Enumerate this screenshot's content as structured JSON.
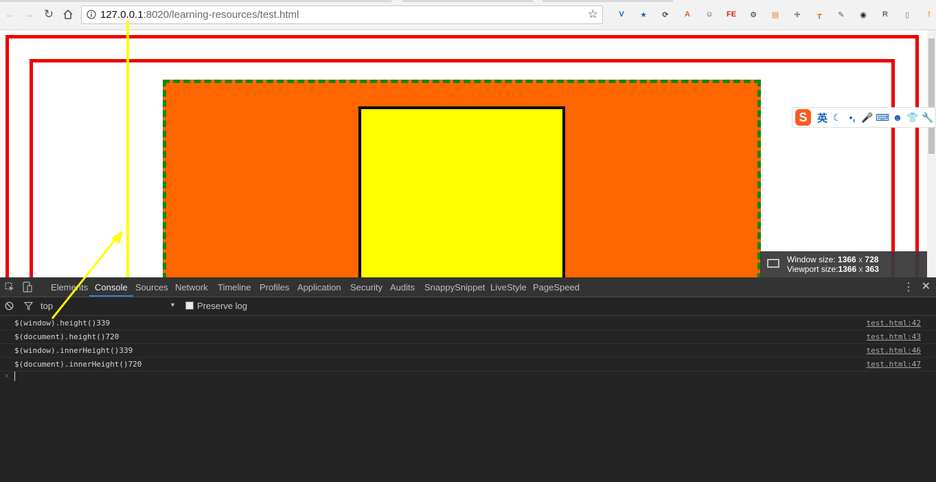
{
  "browser": {
    "url_host": "127.0.0.1",
    "url_port_path": ":8020/learning-resources/test.html",
    "extensions": [
      {
        "icon": "v-extension-icon",
        "glyph": "V",
        "color": "#1a66c2"
      },
      {
        "icon": "bookmark-star-extension-icon",
        "glyph": "★",
        "color": "#2f5fa8"
      },
      {
        "icon": "sync-extension-icon",
        "glyph": "⟳",
        "color": "#444444"
      },
      {
        "icon": "a-extension-icon",
        "glyph": "A",
        "color": "#e05a21"
      },
      {
        "icon": "smiley-extension-icon",
        "glyph": "☺",
        "color": "#333333"
      },
      {
        "icon": "fe-extension-icon",
        "glyph": "FE",
        "color": "#d4261b"
      },
      {
        "icon": "gear-extension-icon",
        "glyph": "⚙",
        "color": "#333333"
      },
      {
        "icon": "note-extension-icon",
        "glyph": "▤",
        "color": "#e0833a"
      },
      {
        "icon": "move-extension-icon",
        "glyph": "✛",
        "color": "#444444"
      },
      {
        "icon": "hammer-extension-icon",
        "glyph": "┲",
        "color": "#c9752c"
      },
      {
        "icon": "eyedropper-extension-icon",
        "glyph": "✎",
        "color": "#555555"
      },
      {
        "icon": "color-wheel-extension-icon",
        "glyph": "◉",
        "color": "#222222"
      },
      {
        "icon": "r-extension-icon",
        "glyph": "R",
        "color": "#666666"
      },
      {
        "icon": "page-extension-icon",
        "glyph": "▯",
        "color": "#777777"
      },
      {
        "icon": "alert-extension-icon",
        "glyph": "!",
        "color": "#f29a1c"
      }
    ]
  },
  "ime": {
    "logo": "S",
    "mode": "英",
    "icons": [
      "moon-icon",
      "punctuation-icon",
      "microphone-icon",
      "keyboard-icon",
      "user-icon",
      "skin-shirt-icon",
      "wrench-icon"
    ],
    "glyphs": [
      "☾",
      "•,",
      "🎤",
      "⌨",
      "☻",
      "👕",
      "🔧"
    ]
  },
  "window_overlay": {
    "line1_label": "Window size:",
    "line1_w": "1366",
    "line1_x": "x",
    "line1_h": "728",
    "line2_label": "Viewport size:",
    "line2_w": "1366",
    "line2_x": "x",
    "line2_h": "363"
  },
  "devtools": {
    "tabs": [
      "Elements",
      "Console",
      "Sources",
      "Network",
      "Timeline",
      "Profiles",
      "Application",
      "Security",
      "Audits",
      "SnappySnippet",
      "LiveStyle",
      "PageSpeed"
    ],
    "active_tab": "Console",
    "context": "top",
    "preserve_log_label": "Preserve log",
    "preserve_log_checked": false,
    "log": [
      {
        "text": "$(window).height()339",
        "source": "test.html:42"
      },
      {
        "text": "$(document).height()720",
        "source": "test.html:43"
      },
      {
        "text": "$(window).innerHeight()339",
        "source": "test.html:46"
      },
      {
        "text": "$(document).innerHeight()720",
        "source": "test.html:47"
      }
    ],
    "prompt_symbol": "›"
  },
  "colors": {
    "red_border": "#ee0000",
    "orange_box": "#ff6600",
    "green_dashed": "#118811",
    "yellow_box": "#ffff00",
    "annotation": "#ffff00",
    "devtools_bg": "#242424"
  }
}
